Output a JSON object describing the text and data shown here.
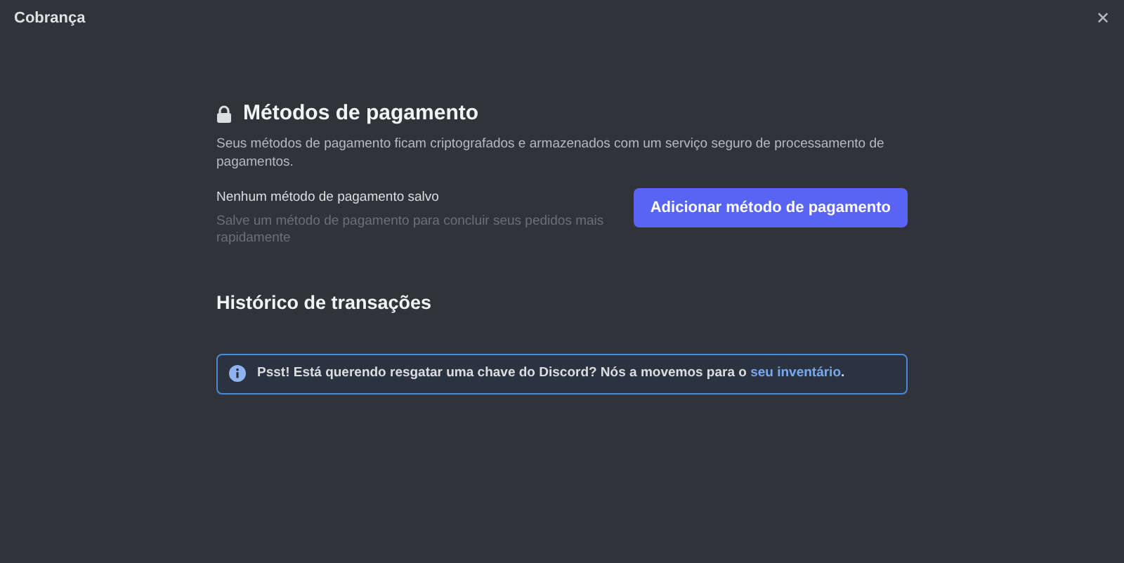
{
  "window": {
    "title": "Cobrança",
    "close": "✕"
  },
  "payment": {
    "title": "Métodos de pagamento",
    "description": "Seus métodos de pagamento ficam criptografados e armazenados com um serviço seguro de processamento de pagamentos.",
    "empty_title": "Nenhum método de pagamento salvo",
    "empty_hint": "Salve um método de pagamento para concluir seus pedidos mais rapidamente",
    "add_button": "Adicionar método de pagamento"
  },
  "history": {
    "title": "Histórico de transações",
    "notice": {
      "text": "Psst! Está querendo resgatar uma chave do Discord? Nós a movemos para o ",
      "link": "seu inventário",
      "text_after": "."
    }
  }
}
